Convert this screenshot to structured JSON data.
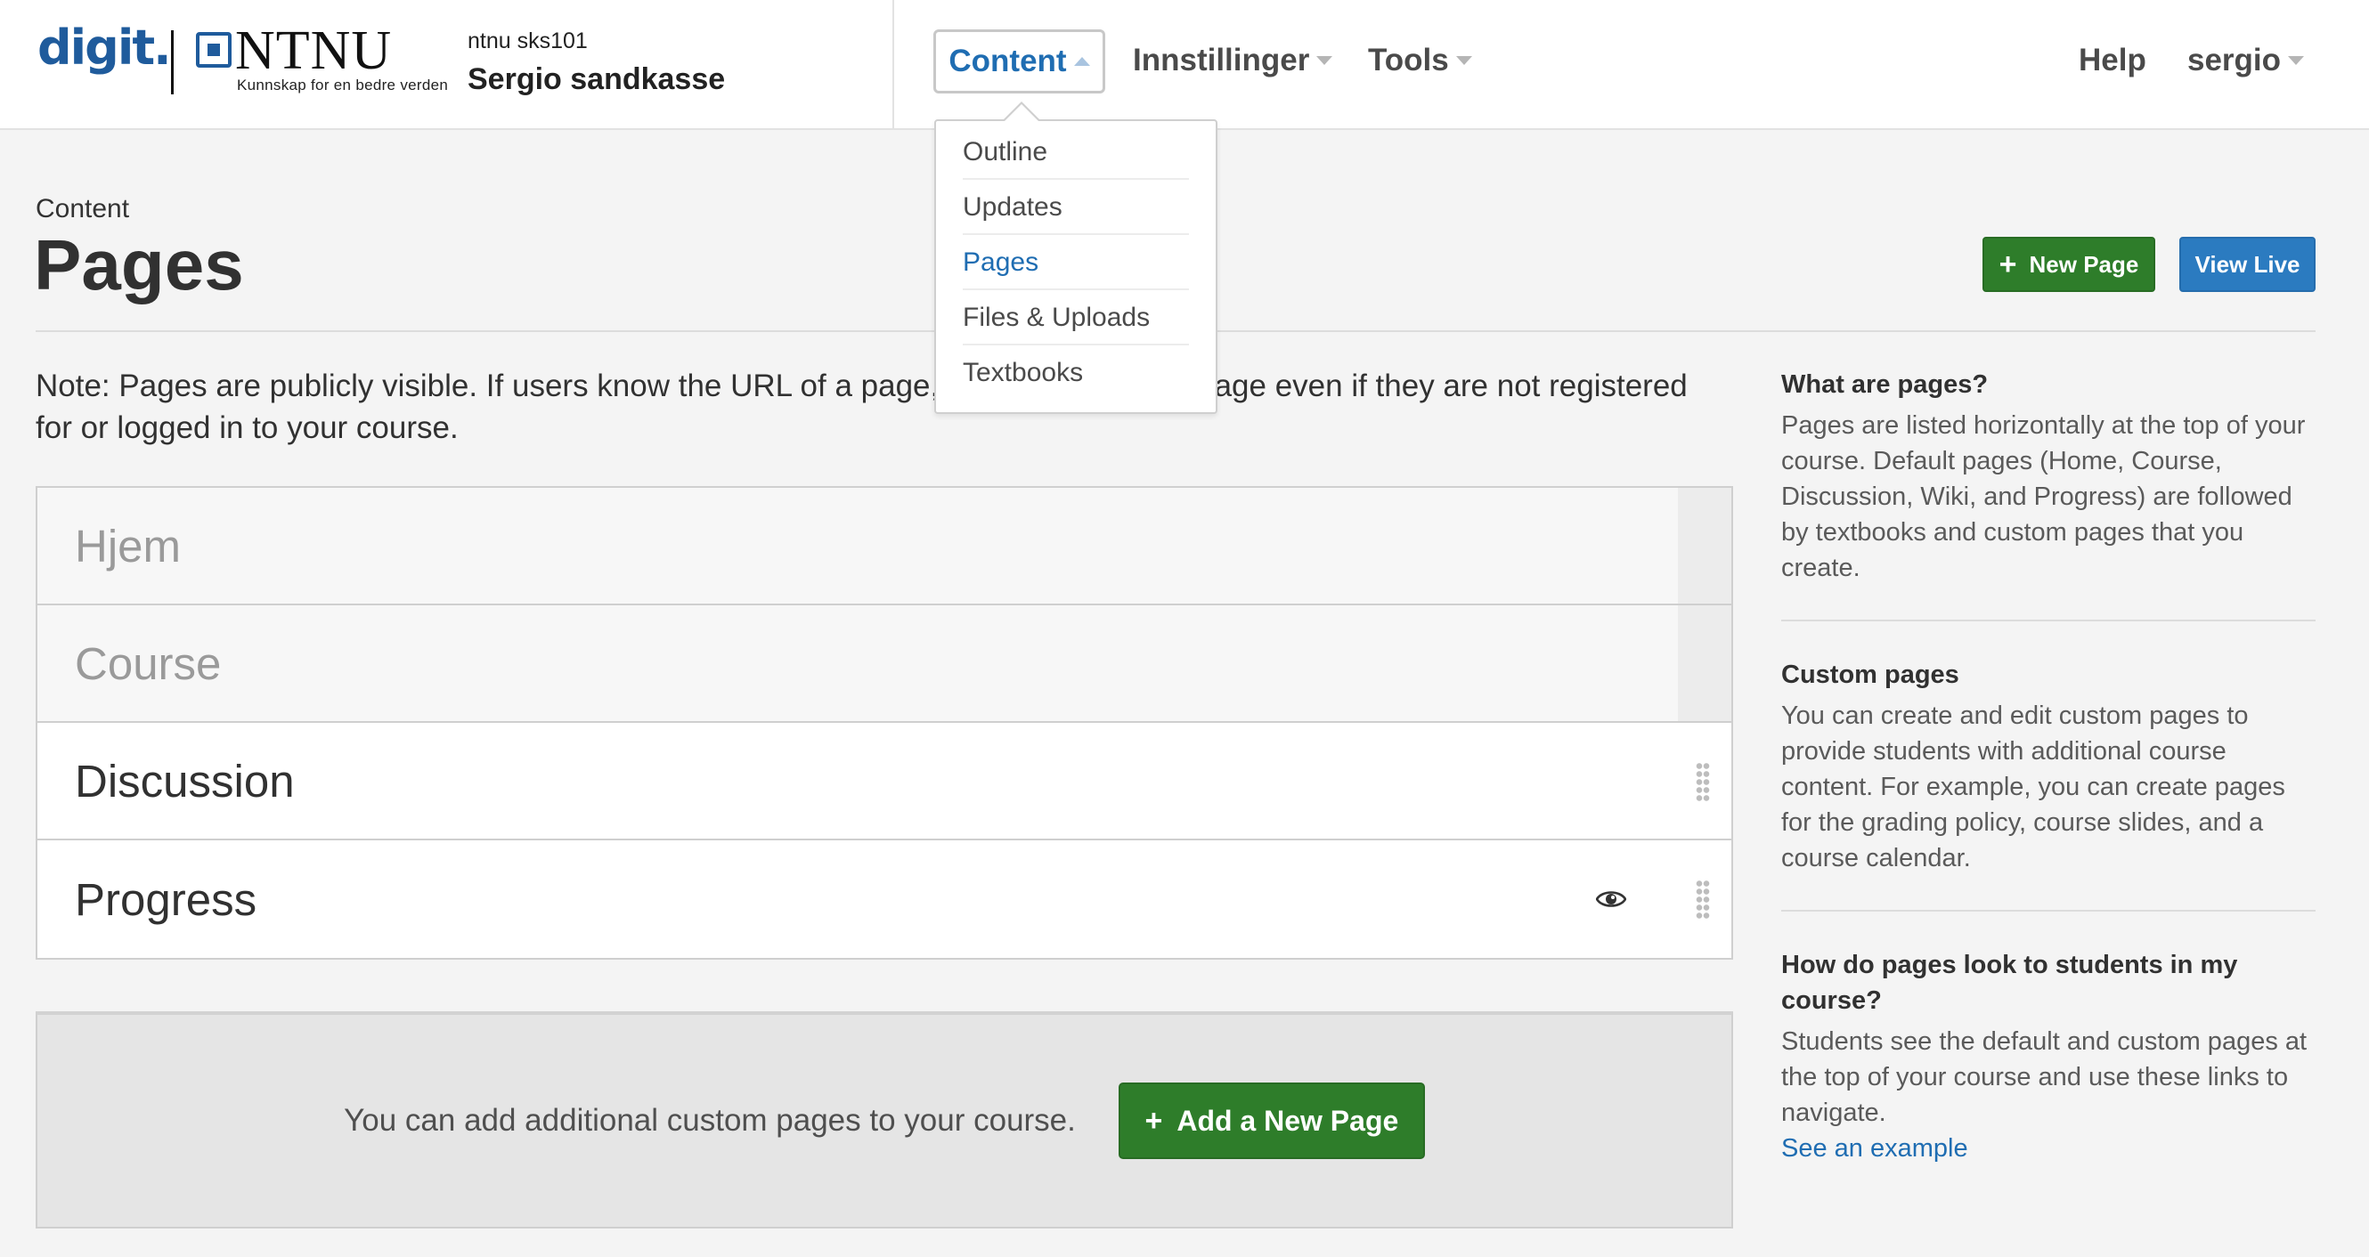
{
  "header": {
    "logo_digit": "digit.",
    "logo_ntnu": "NTNU",
    "logo_tagline": "Kunnskap for en bedre verden",
    "course_code": "ntnu  sks101",
    "course_name": "Sergio sandkasse",
    "nav": {
      "content": "Content",
      "settings": "Innstillinger",
      "tools": "Tools",
      "help": "Help",
      "user": "sergio"
    }
  },
  "content_menu": [
    {
      "label": "Outline",
      "active": false
    },
    {
      "label": "Updates",
      "active": false
    },
    {
      "label": "Pages",
      "active": true
    },
    {
      "label": "Files & Uploads",
      "active": false
    },
    {
      "label": "Textbooks",
      "active": false
    }
  ],
  "page_header": {
    "breadcrumb": "Content",
    "title": "Pages",
    "new_page_button": "New Page",
    "view_live_button": "View Live"
  },
  "note": "Note: Pages are publicly visible. If users know the URL of a page, they can view the page even if they are not registered for or logged in to your course.",
  "pages": [
    {
      "label": "Hjem",
      "kind": "fixed"
    },
    {
      "label": "Course",
      "kind": "fixed"
    },
    {
      "label": "Discussion",
      "kind": "custom"
    },
    {
      "label": "Progress",
      "kind": "custom",
      "visibility_icon": "eye-icon"
    }
  ],
  "add_section": {
    "text": "You can add additional custom pages to your course.",
    "button": "Add a New Page"
  },
  "sidebar": {
    "what_title": "What are pages?",
    "what_text": "Pages are listed horizontally at the top of your course. Default pages (Home, Course, Discussion, Wiki, and Progress) are followed by textbooks and custom pages that you create.",
    "custom_title": "Custom pages",
    "custom_text": "You can create and edit custom pages to provide students with additional course content. For example, you can create pages for the grading policy, course slides, and a course calendar.",
    "look_title": "How do pages look to students in my course?",
    "look_text": "Students see the default and custom pages at the top of your course and use these links to navigate.",
    "look_link": "See an example"
  },
  "colors": {
    "brand_blue": "#1f5b9c",
    "link_blue": "#1f6db2",
    "green": "#2e7d2a",
    "button_blue": "#2b7bc0"
  }
}
